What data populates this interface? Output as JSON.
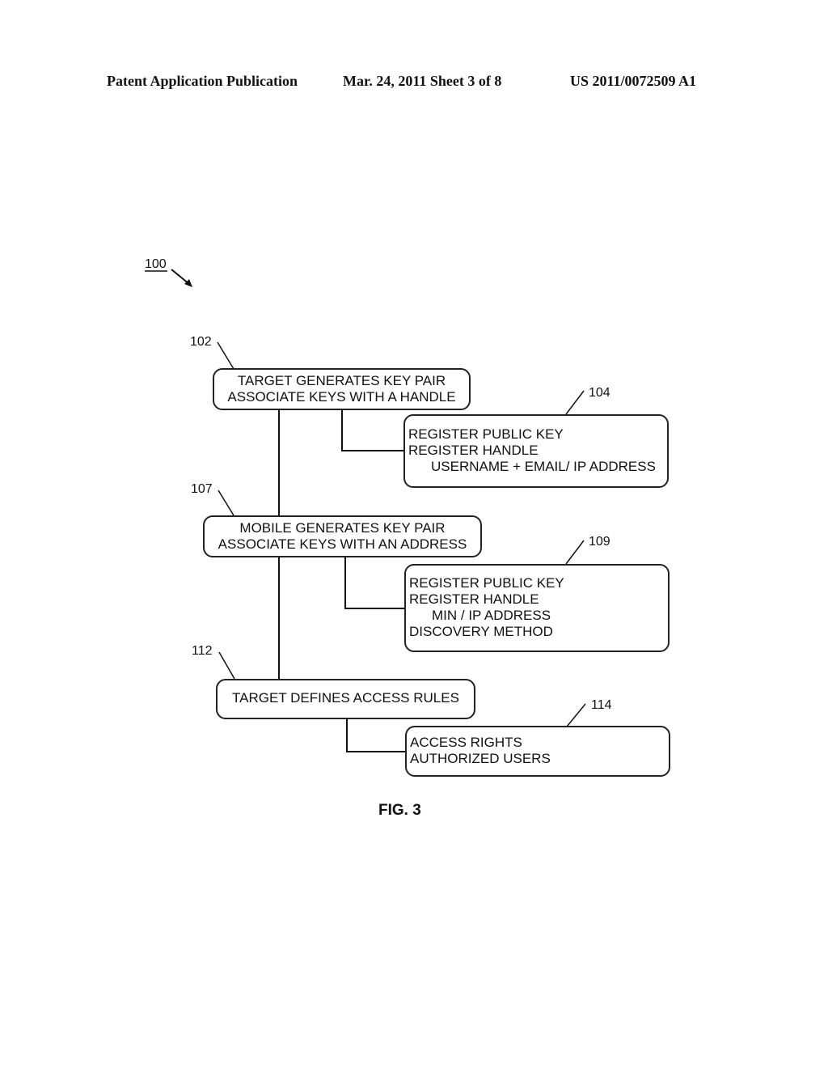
{
  "header": {
    "publication": "Patent Application Publication",
    "date_sheet": "Mar. 24, 2011  Sheet 3 of 8",
    "number": "US 2011/0072509 A1"
  },
  "diagram": {
    "ref_main": "100",
    "nodes": [
      {
        "ref": "102",
        "lines": [
          "TARGET GENERATES KEY PAIR",
          "ASSOCIATE KEYS WITH A HANDLE"
        ]
      },
      {
        "ref": "104",
        "lines": [
          "REGISTER PUBLIC KEY",
          "REGISTER HANDLE",
          "USERNAME + EMAIL/ IP ADDRESS"
        ]
      },
      {
        "ref": "107",
        "lines": [
          "MOBILE GENERATES KEY PAIR",
          "ASSOCIATE KEYS WITH AN ADDRESS"
        ]
      },
      {
        "ref": "109",
        "lines": [
          "REGISTER PUBLIC KEY",
          "REGISTER HANDLE",
          "MIN / IP ADDRESS",
          "DISCOVERY METHOD"
        ]
      },
      {
        "ref": "112",
        "lines": [
          "TARGET DEFINES ACCESS RULES"
        ]
      },
      {
        "ref": "114",
        "lines": [
          "ACCESS RIGHTS",
          "AUTHORIZED USERS"
        ]
      }
    ],
    "figure_label": "FIG. 3"
  }
}
